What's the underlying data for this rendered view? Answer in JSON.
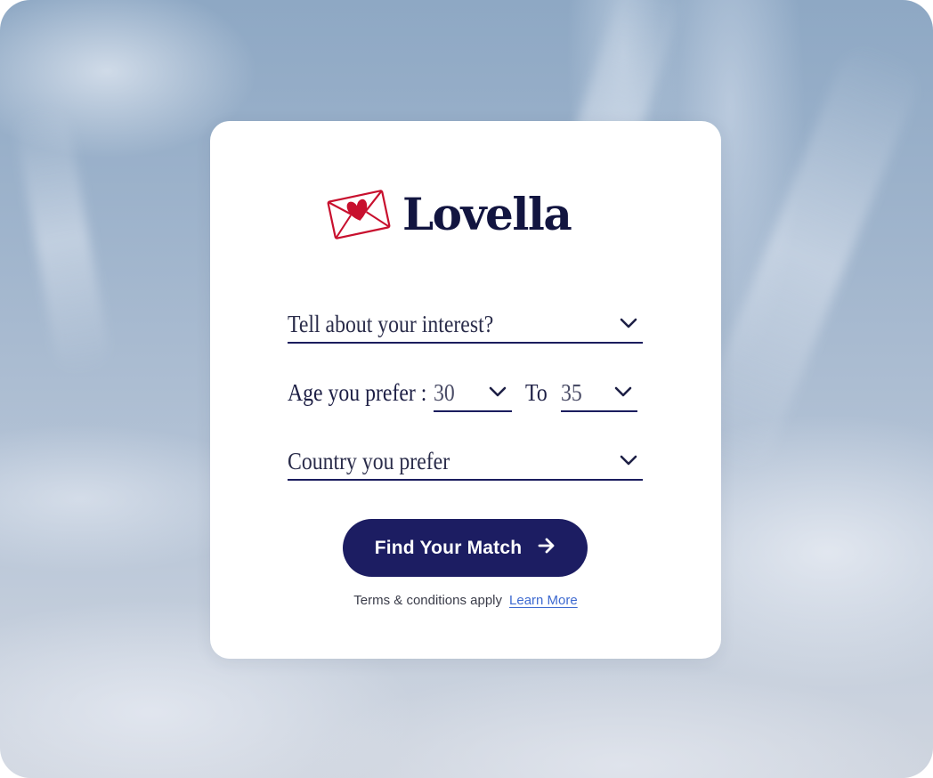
{
  "brand": {
    "name": "Lovella",
    "logo_icon": "love-letter-envelope-icon",
    "icon_color": "#c8102e",
    "text_color": "#121540"
  },
  "form": {
    "interest": {
      "placeholder": "Tell about your interest?",
      "icon": "chevron-down-icon"
    },
    "age": {
      "label": "Age you prefer :",
      "from_value": "30",
      "separator": "To",
      "to_value": "35",
      "icon": "chevron-down-icon"
    },
    "country": {
      "placeholder": "Country you prefer",
      "icon": "chevron-down-icon"
    },
    "submit": {
      "label": "Find Your Match",
      "icon": "arrow-right-icon",
      "color": "#1c1d62"
    }
  },
  "footer": {
    "terms": "Terms & conditions apply",
    "link": "Learn More",
    "link_color": "#3e6ad0"
  }
}
